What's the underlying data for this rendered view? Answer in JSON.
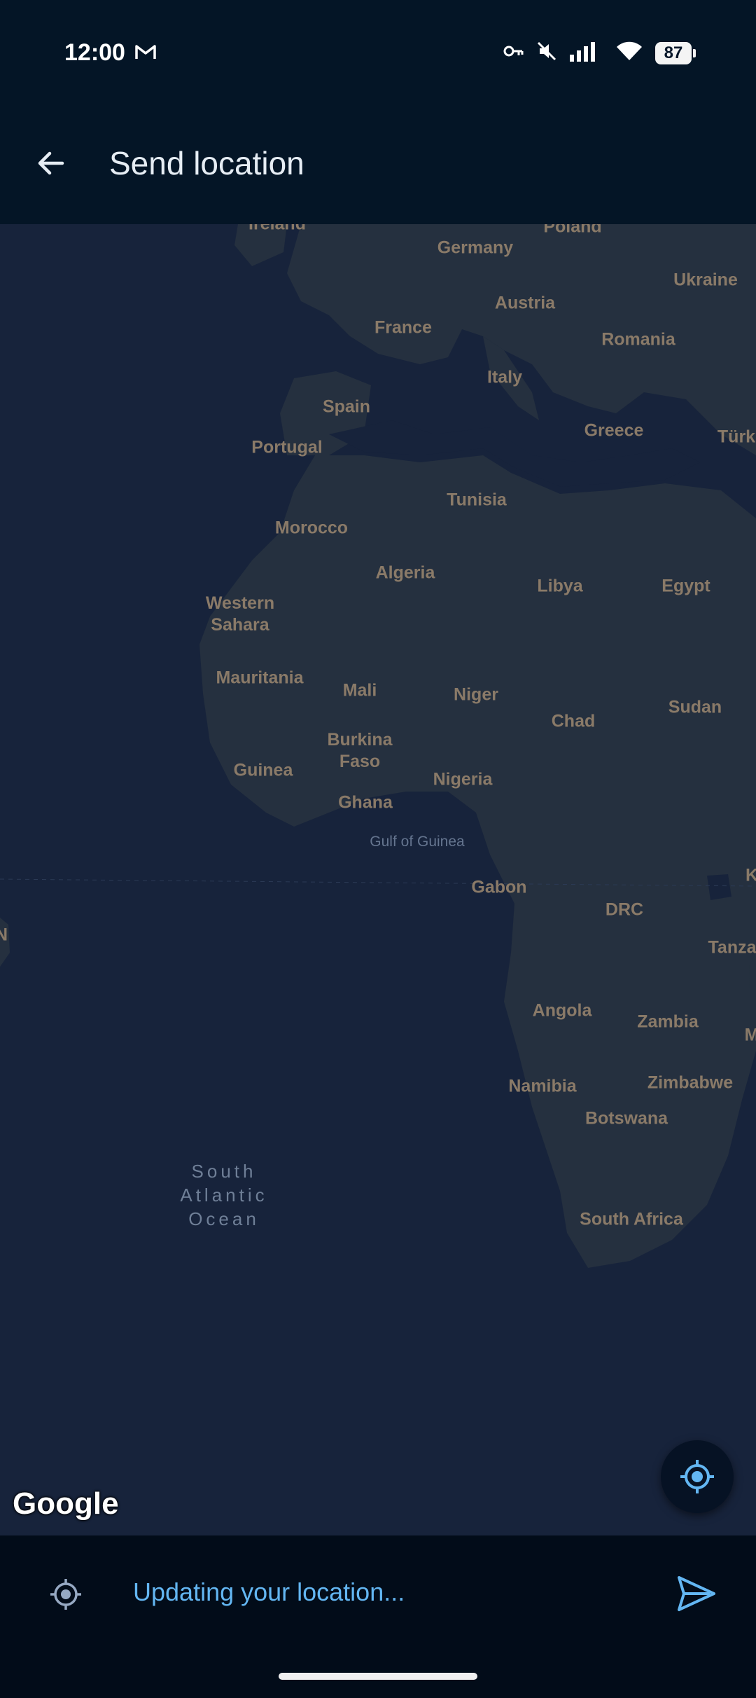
{
  "status_bar": {
    "time": "12:00",
    "battery": "87",
    "icons": [
      "gmail-icon",
      "vpn-key-icon",
      "mute-icon",
      "signal-icon",
      "wifi-icon",
      "battery-icon"
    ]
  },
  "app_bar": {
    "title": "Send location",
    "back_icon": "arrow-back-icon"
  },
  "map": {
    "countries": [
      "Ireland",
      "Poland",
      "Germany",
      "Ukraine",
      "Austria",
      "France",
      "Romania",
      "Italy",
      "Spain",
      "Greece",
      "Türk",
      "Portugal",
      "Tunisia",
      "Morocco",
      "Algeria",
      "Libya",
      "Egypt",
      "Western\nSahara",
      "Mauritania",
      "Mali",
      "Niger",
      "Chad",
      "Sudan",
      "Burkina\nFaso",
      "Guinea",
      "Nigeria",
      "Ghana",
      "Gabon",
      "DRC",
      "K",
      "N",
      "Tanza",
      "Angola",
      "Zambia",
      "M",
      "Namibia",
      "Zimbabwe",
      "Botswana",
      "South Africa"
    ],
    "water_label": "Gulf of Guinea",
    "ocean_label": "South\nAtlantic\nOcean",
    "attribution": "Google",
    "my_location_icon": "my-location-icon"
  },
  "bottom_bar": {
    "status_text": "Updating your location...",
    "left_icon": "location-target-icon",
    "send_icon": "send-icon"
  },
  "colors": {
    "background": "#041526",
    "ocean": "#17233b",
    "land": "#25303f",
    "accent": "#63b6f2"
  }
}
